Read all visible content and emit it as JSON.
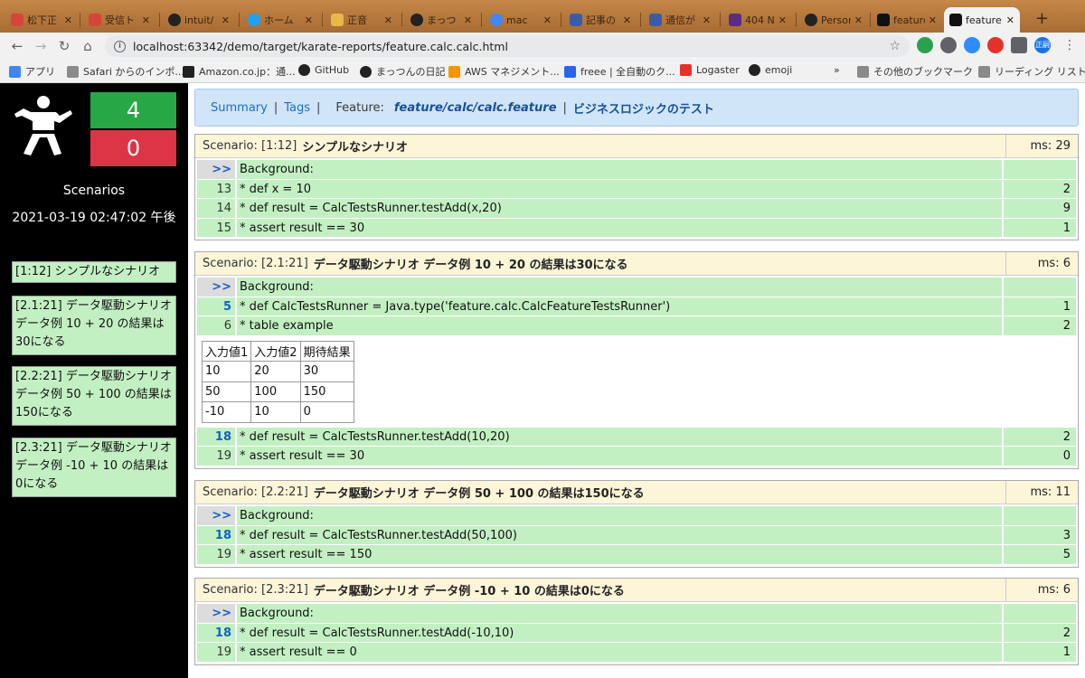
{
  "browser": {
    "tabs": [
      {
        "title": "松下正",
        "color": "#d44638"
      },
      {
        "title": "受信ト",
        "color": "#d44638"
      },
      {
        "title": "intuit/",
        "color": "#222222"
      },
      {
        "title": "ホーム",
        "color": "#1da1f2"
      },
      {
        "title": "正音",
        "color": "#e8b84a"
      },
      {
        "title": "まっつ",
        "color": "#222222"
      },
      {
        "title": "mac",
        "color": "#4285f4"
      },
      {
        "title": "記事の",
        "color": "#3b5ba9"
      },
      {
        "title": "通信が",
        "color": "#3b5ba9"
      },
      {
        "title": "404 N",
        "color": "#5a2d82"
      },
      {
        "title": "Person",
        "color": "#222222"
      },
      {
        "title": "feature",
        "color": "#111111"
      },
      {
        "title": "feature",
        "color": "#111111"
      }
    ],
    "tab_close": "✕",
    "newtab": "+",
    "url": "localhost:63342/demo/target/karate-reports/feature.calc.calc.html",
    "profile_label": "正嗣",
    "bookmarks": [
      {
        "label": "アプリ",
        "color": "#4285f4"
      },
      {
        "label": "Safari からのインポ...",
        "color": "#8a8a8a"
      },
      {
        "label": "Amazon.co.jp：通...",
        "color": "#222222"
      },
      {
        "label": "GitHub",
        "color": "#222222"
      },
      {
        "label": "まっつんの日記",
        "color": "#222222"
      },
      {
        "label": "AWS マネジメント...",
        "color": "#f79400"
      },
      {
        "label": "freee | 全自動のク...",
        "color": "#2864f0"
      },
      {
        "label": "Logaster",
        "color": "#e4322b"
      },
      {
        "label": "emoji",
        "color": "#222222"
      },
      {
        "label": "»",
        "color": ""
      },
      {
        "label": "その他のブックマーク",
        "color": "#8a8a8a"
      },
      {
        "label": "リーディング リスト",
        "color": "#8a8a8a"
      }
    ]
  },
  "sidebar": {
    "passed": "4",
    "failed": "0",
    "heading": "Scenarios",
    "date": "2021-03-19 02:47:02 午後",
    "items": [
      "[1:12] シンプルなシナリオ",
      "[2.1:21] データ駆動シナリオ データ例 10 + 20 の結果は30になる",
      "[2.2:21] データ駆動シナリオ データ例 50 + 100 の結果は150になる",
      "[2.3:21] データ駆動シナリオ データ例 -10 + 10 の結果は0になる"
    ]
  },
  "nav": {
    "summary": "Summary",
    "sep1": "|",
    "tags": "Tags",
    "sep2": "|",
    "feature_label": "Feature:",
    "feature_path": "feature/calc/calc.feature",
    "sep3": "|",
    "feature_desc": "ビジネスロジックのテスト"
  },
  "scenarios": [
    {
      "label": "Scenario: [1:12]",
      "name": "シンプルなシナリオ",
      "ms": "ms: 29",
      "steps": [
        {
          "ln": ">>",
          "text": "Background:",
          "ms": ""
        },
        {
          "ln": "13",
          "text": "* def x = 10",
          "ms": "2"
        },
        {
          "ln": "14",
          "text": "* def result = CalcTestsRunner.testAdd(x,20)",
          "ms": "9"
        },
        {
          "ln": "15",
          "text": "* assert result == 30",
          "ms": "1"
        }
      ]
    },
    {
      "label": "Scenario: [2.1:21]",
      "name": "データ駆動シナリオ データ例 10 + 20 の結果は30になる",
      "ms": "ms: 6",
      "steps": [
        {
          "ln": ">>",
          "text": "Background:",
          "ms": ""
        },
        {
          "ln": "5",
          "text": "* def CalcTestsRunner = Java.type('feature.calc.CalcFeatureTestsRunner')",
          "ms": "1"
        },
        {
          "ln": "6",
          "text": "* table example",
          "ms": "2"
        }
      ],
      "table": [
        [
          "入力値1",
          "入力値2",
          "期待結果"
        ],
        [
          "10",
          "20",
          "30"
        ],
        [
          "50",
          "100",
          "150"
        ],
        [
          "-10",
          "10",
          "0"
        ]
      ],
      "steps_after": [
        {
          "ln": "18",
          "text": "* def result = CalcTestsRunner.testAdd(10,20)",
          "ms": "2"
        },
        {
          "ln": "19",
          "text": "* assert result == 30",
          "ms": "0"
        }
      ]
    },
    {
      "label": "Scenario: [2.2:21]",
      "name": "データ駆動シナリオ データ例 50 + 100 の結果は150になる",
      "ms": "ms: 11",
      "steps": [
        {
          "ln": ">>",
          "text": "Background:",
          "ms": ""
        },
        {
          "ln": "18",
          "text": "* def result = CalcTestsRunner.testAdd(50,100)",
          "ms": "3"
        },
        {
          "ln": "19",
          "text": "* assert result == 150",
          "ms": "5"
        }
      ]
    },
    {
      "label": "Scenario: [2.3:21]",
      "name": "データ駆動シナリオ データ例 -10 + 10 の結果は0になる",
      "ms": "ms: 6",
      "steps": [
        {
          "ln": ">>",
          "text": "Background:",
          "ms": ""
        },
        {
          "ln": "18",
          "text": "* def result = CalcTestsRunner.testAdd(-10,10)",
          "ms": "2"
        },
        {
          "ln": "19",
          "text": "* assert result == 0",
          "ms": "1"
        }
      ]
    }
  ]
}
